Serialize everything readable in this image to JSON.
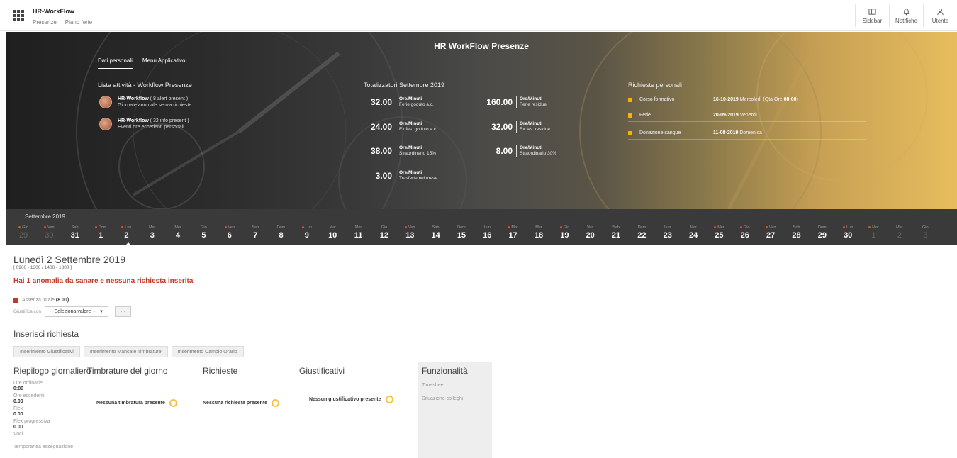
{
  "app": {
    "title": "HR-WorkFlow",
    "nav": [
      "Presenze",
      "Piano ferie"
    ],
    "actions": [
      {
        "label": "Sidebar",
        "icon": "sidebar-icon"
      },
      {
        "label": "Notifiche",
        "icon": "bell-icon"
      },
      {
        "label": "Utente",
        "icon": "user-icon"
      }
    ]
  },
  "hero": {
    "title": "HR WorkFlow Presenze",
    "tabs": [
      "Dati personali",
      "Menu Applicativo"
    ],
    "activities": {
      "title": "Lista attività - Workflow Presenze",
      "items": [
        {
          "app": "HR-Workflow",
          "note": "( 8 alert present )",
          "desc": "Giornate anomale senza richieste"
        },
        {
          "app": "HR-Workflow",
          "note": "( 32 info present )",
          "desc": "Eventi ore eccedenti personali"
        }
      ]
    },
    "totals": {
      "title": "Totalizzatori Settembre 2019",
      "unit": "Ore/Minuti",
      "items": [
        {
          "value": "32.00",
          "label": "Ferie goduto a.c."
        },
        {
          "value": "160.00",
          "label": "Ferie residue"
        },
        {
          "value": "24.00",
          "label": "Ex fes. goduto a.c."
        },
        {
          "value": "32.00",
          "label": "Ex fes. residue"
        },
        {
          "value": "38.00",
          "label": "Straordinario 15%"
        },
        {
          "value": "8.00",
          "label": "Straordinario 30%"
        },
        {
          "value": "3.00",
          "label": "Trasferte nel mese"
        }
      ]
    },
    "requests": {
      "title": "Richieste personali",
      "items": [
        {
          "name": "Corso formativo",
          "date": "16-10-2019",
          "rest": " Mercoledì (Qta Ore ",
          "hours": "08:00",
          "close": ")"
        },
        {
          "name": "Ferie",
          "date": "20-09-2019",
          "rest": " Venerdì",
          "hours": "",
          "close": ""
        },
        {
          "name": "Donazione sangue",
          "date": "11-08-2019",
          "rest": " Domenica",
          "hours": "",
          "close": ""
        }
      ]
    }
  },
  "calendar": {
    "month": "Settembre 2019",
    "days": [
      {
        "dow": "Gio",
        "num": "29",
        "dot": true,
        "dim": true
      },
      {
        "dow": "Ven",
        "num": "30",
        "dot": true,
        "dim": true
      },
      {
        "dow": "Sab",
        "num": "31",
        "dot": false,
        "dim": false
      },
      {
        "dow": "Dom",
        "num": "1",
        "dot": true,
        "dim": false
      },
      {
        "dow": "Lun",
        "num": "2",
        "dot": true,
        "dim": false
      },
      {
        "dow": "Mar",
        "num": "3",
        "dot": false,
        "dim": false
      },
      {
        "dow": "Mer",
        "num": "4",
        "dot": false,
        "dim": false
      },
      {
        "dow": "Gio",
        "num": "5",
        "dot": false,
        "dim": false
      },
      {
        "dow": "Ven",
        "num": "6",
        "dot": true,
        "dim": false
      },
      {
        "dow": "Sab",
        "num": "7",
        "dot": false,
        "dim": false
      },
      {
        "dow": "Dom",
        "num": "8",
        "dot": false,
        "dim": false
      },
      {
        "dow": "Lun",
        "num": "9",
        "dot": true,
        "dim": false
      },
      {
        "dow": "Mar",
        "num": "10",
        "dot": false,
        "dim": false
      },
      {
        "dow": "Mer",
        "num": "11",
        "dot": false,
        "dim": false
      },
      {
        "dow": "Gio",
        "num": "12",
        "dot": false,
        "dim": false
      },
      {
        "dow": "Ven",
        "num": "13",
        "dot": true,
        "dim": false
      },
      {
        "dow": "Sab",
        "num": "14",
        "dot": false,
        "dim": false
      },
      {
        "dow": "Dom",
        "num": "15",
        "dot": false,
        "dim": false
      },
      {
        "dow": "Lun",
        "num": "16",
        "dot": false,
        "dim": false
      },
      {
        "dow": "Mar",
        "num": "17",
        "dot": true,
        "dim": false
      },
      {
        "dow": "Mer",
        "num": "18",
        "dot": false,
        "dim": false
      },
      {
        "dow": "Gio",
        "num": "19",
        "dot": true,
        "dim": false
      },
      {
        "dow": "Ven",
        "num": "20",
        "dot": false,
        "dim": false
      },
      {
        "dow": "Sab",
        "num": "21",
        "dot": false,
        "dim": false
      },
      {
        "dow": "Dom",
        "num": "22",
        "dot": false,
        "dim": false
      },
      {
        "dow": "Lun",
        "num": "23",
        "dot": false,
        "dim": false
      },
      {
        "dow": "Mar",
        "num": "24",
        "dot": false,
        "dim": false
      },
      {
        "dow": "Mer",
        "num": "25",
        "dot": true,
        "dim": false
      },
      {
        "dow": "Gio",
        "num": "26",
        "dot": true,
        "dim": false
      },
      {
        "dow": "Ven",
        "num": "27",
        "dot": true,
        "dim": false
      },
      {
        "dow": "Sab",
        "num": "28",
        "dot": false,
        "dim": false
      },
      {
        "dow": "Dom",
        "num": "29",
        "dot": false,
        "dim": false
      },
      {
        "dow": "Lun",
        "num": "30",
        "dot": true,
        "dim": false
      },
      {
        "dow": "Mar",
        "num": "1",
        "dot": true,
        "dim": true
      },
      {
        "dow": "Mer",
        "num": "2",
        "dot": false,
        "dim": true
      },
      {
        "dow": "Gio",
        "num": "3",
        "dot": false,
        "dim": true
      }
    ]
  },
  "day": {
    "title": "Lunedì 2 Settembre 2019",
    "hours": "[ 0900 - 1300 / 1400 - 1800 ]",
    "anomaly": "Hai 1 anomalia da sanare e nessuna richiesta inserita",
    "absence_label": "Assenza totale",
    "absence_value": "(8.00)",
    "justify_label": "Giustifica con",
    "select_value": "-- Seleziona valore --",
    "more_label": "···"
  },
  "insert": {
    "title": "Inserisci richiesta",
    "buttons": [
      "Inserimento Giustificativi",
      "Inserimento Mancate Timbrature",
      "Inserimento Cambio Orario"
    ]
  },
  "summary": {
    "title": "Riepilogo giornaliero",
    "rows": [
      {
        "label": "Ore ordinarie",
        "value": "0:00"
      },
      {
        "label": "Ore eccedenti",
        "value": "0.00"
      },
      {
        "label": "Flex",
        "value": "0.00"
      },
      {
        "label": "Flex progressiva",
        "value": "0.00"
      },
      {
        "label": "Voci",
        "value": ""
      },
      {
        "label": "Temporanea assegnazione",
        "value": ""
      }
    ]
  },
  "punches": {
    "title": "Timbrature del giorno",
    "empty": "Nessuna timbratura presente"
  },
  "requests": {
    "title": "Richieste",
    "empty": "Nessuna richiesta presente"
  },
  "justifications": {
    "title": "Giustificativi",
    "empty": "Nessun giustificativo presente"
  },
  "functions": {
    "title": "Funzionalità",
    "items": [
      "Timesheet",
      "Situazione colleghi"
    ]
  },
  "colors": {
    "accent": "#f5b400",
    "alert": "#c0392b",
    "calendar_bg": "#3a3a3a"
  }
}
